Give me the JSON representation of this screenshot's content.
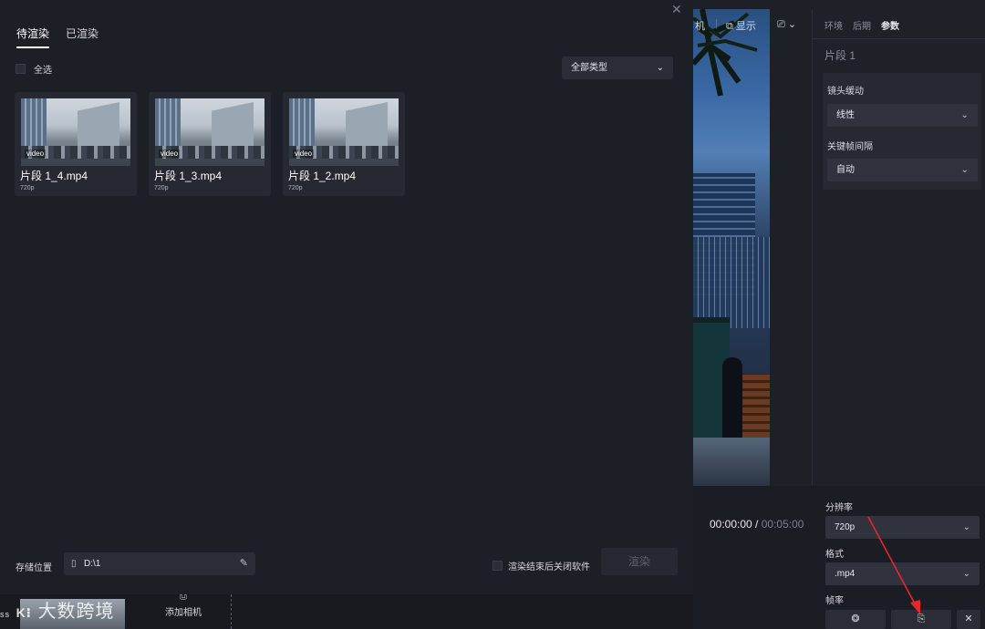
{
  "dialog": {
    "tabs": [
      "待渲染",
      "已渲染"
    ],
    "select_all": "全选",
    "type_filter": "全部类型",
    "cards": [
      {
        "name": "片段 1_4.mp4",
        "resolution": "720p",
        "tag": "video"
      },
      {
        "name": "片段 1_3.mp4",
        "resolution": "720p",
        "tag": "video"
      },
      {
        "name": "片段 1_2.mp4",
        "resolution": "720p",
        "tag": "video"
      }
    ],
    "storage_label": "存储位置",
    "storage_path": "D:\\1",
    "close_after_render": "渲染结束后关闭软件",
    "render_button": "渲染"
  },
  "editor": {
    "toolbar": {
      "camera": "机",
      "display": "显示"
    },
    "right_tabs": [
      "环境",
      "后期",
      "参数"
    ],
    "segment_title": "片段 1",
    "lens_ease_label": "镜头缓动",
    "lens_ease_value": "线性",
    "keyframe_interval_label": "关键帧间隔",
    "keyframe_interval_value": "自动",
    "timecode_current": "00:00:00",
    "timecode_sep": " / ",
    "timecode_total": "00:05:00",
    "resolution_label": "分辨率",
    "resolution_value": "720p",
    "format_label": "格式",
    "format_value": ".mp4",
    "framerate_label": "帧率",
    "add_camera": "添加相机",
    "watermark": "大数跨境",
    "watermark_prefix": "ss"
  },
  "colors": {
    "accent": "#2e7cf6",
    "arrow": "#e8262c"
  }
}
